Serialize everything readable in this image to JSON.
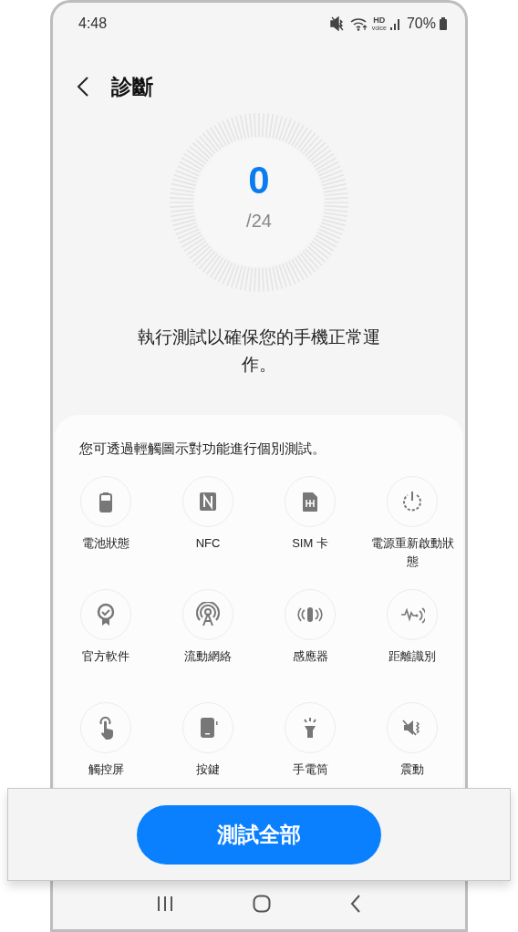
{
  "status_bar": {
    "time": "4:48",
    "hd_label": "HD",
    "hd_sub": "voice",
    "battery": "70%"
  },
  "header": {
    "title": "診斷"
  },
  "progress": {
    "count": "0",
    "total": "/24"
  },
  "intro": "執行測試以確保您的手機正常運作。",
  "card": {
    "hint": "您可透過輕觸圖示對功能進行個別測試。",
    "tests": [
      {
        "label": "電池狀態"
      },
      {
        "label": "NFC"
      },
      {
        "label": "SIM 卡"
      },
      {
        "label": "電源重新啟動狀態"
      },
      {
        "label": "官方軟件"
      },
      {
        "label": "流動網絡"
      },
      {
        "label": "感應器"
      },
      {
        "label": "距離識別"
      },
      {
        "label": "觸控屏"
      },
      {
        "label": "按鍵"
      },
      {
        "label": "手電筒"
      },
      {
        "label": "震動"
      }
    ]
  },
  "action_button": "測試全部"
}
